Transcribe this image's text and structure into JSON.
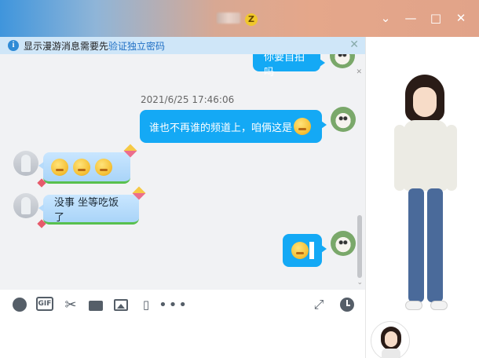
{
  "notice": {
    "text": "显示漫游消息需要先",
    "link": "验证独立密码"
  },
  "window": {
    "badge": "Z",
    "collapse_icon": "chevron-down-icon",
    "minimize_icon": "minimize-icon",
    "maximize_icon": "maximize-icon",
    "close_icon": "close-icon"
  },
  "messages": {
    "partial_top": "你要自拍吗",
    "timestamp": "2021/6/25 17:46:06",
    "msg1": "谁也不再谁的频道上，咱俩这是",
    "msg3": "没事 坐等吃饭了"
  },
  "toolbar": {
    "gif_label": "GIF",
    "more_label": "•••"
  },
  "colors": {
    "accent": "#14a9f5",
    "notice_bg": "#cfe6f8"
  }
}
